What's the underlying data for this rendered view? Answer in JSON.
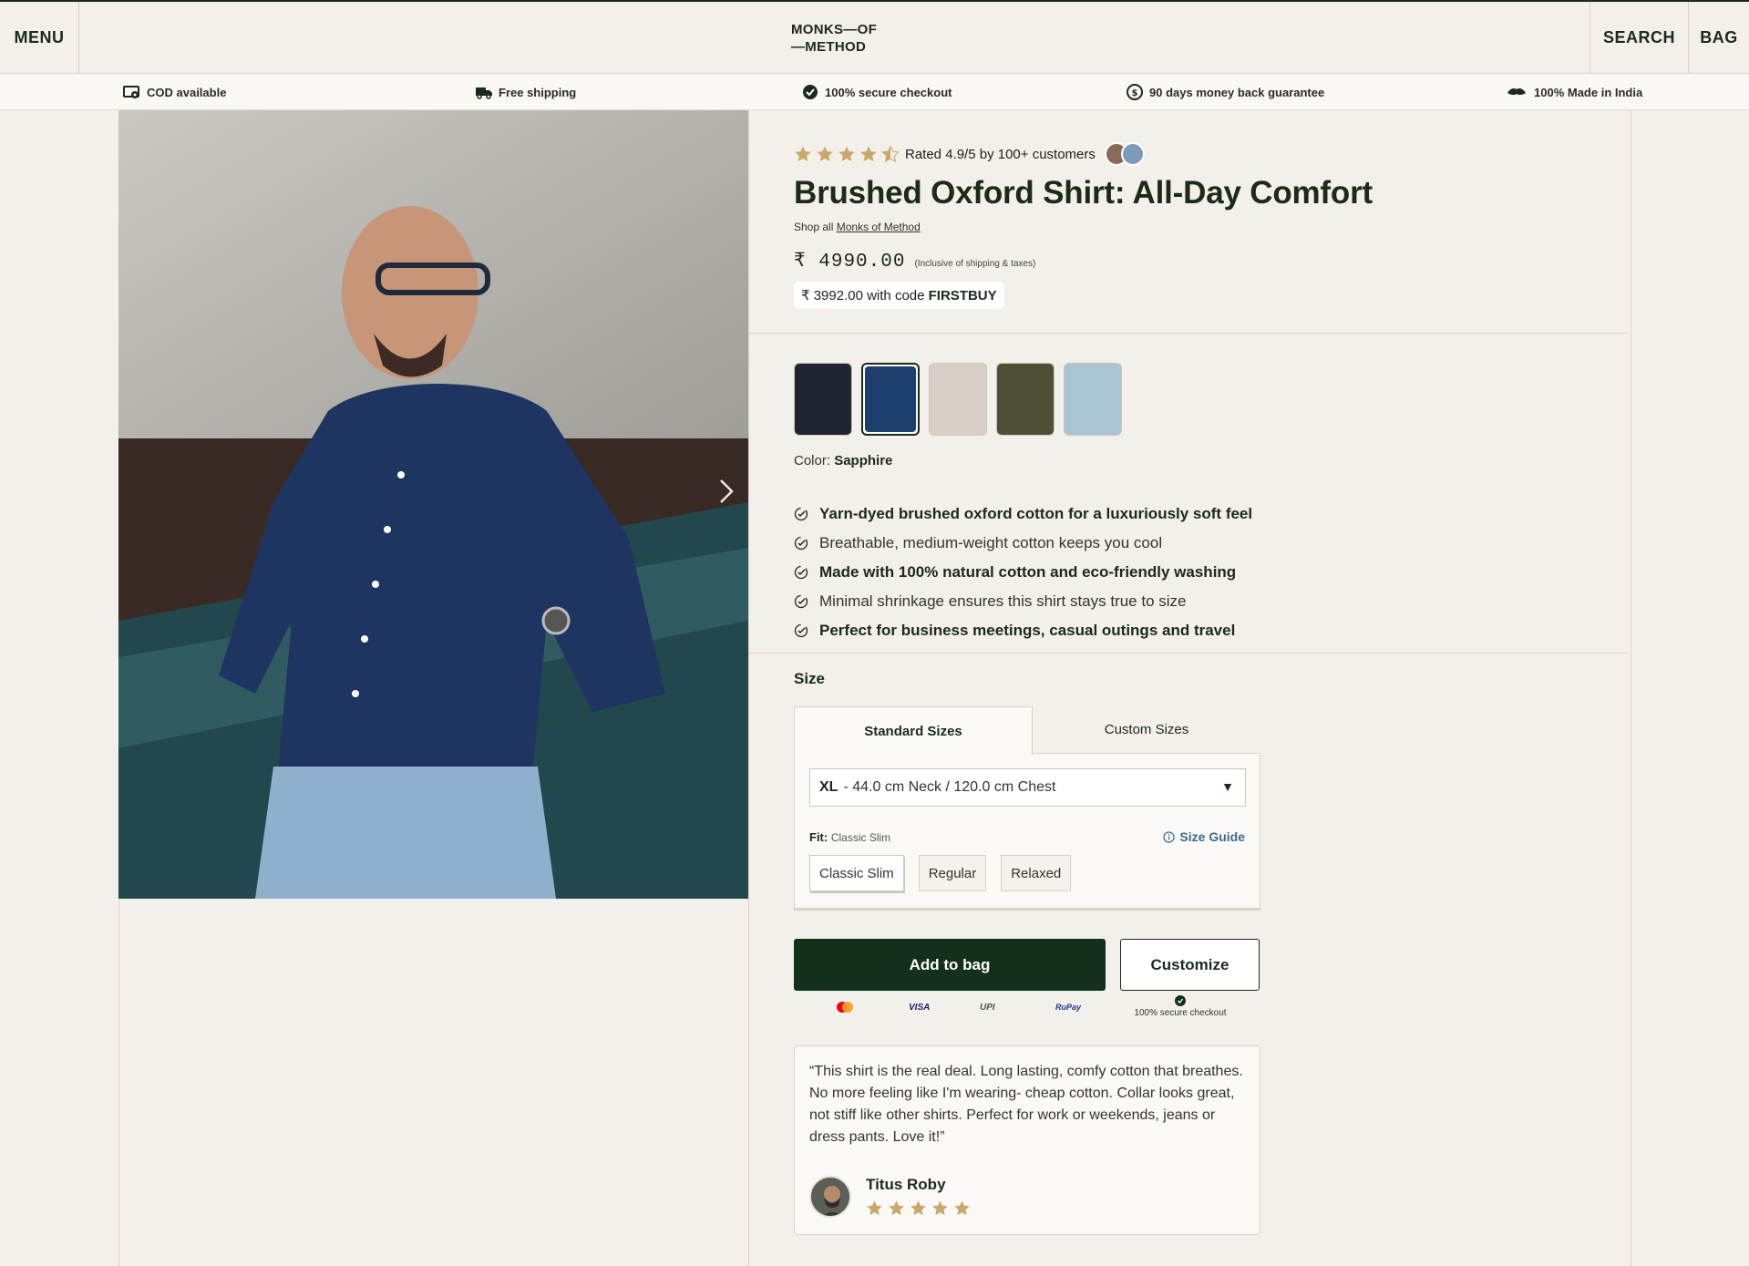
{
  "header": {
    "menu_label": "MENU",
    "logo_line1": "MONKS—OF",
    "logo_line2": "—METHOD",
    "search_label": "SEARCH",
    "bag_label": "BAG"
  },
  "trustbar": [
    {
      "icon": "cod-icon",
      "label": "COD available"
    },
    {
      "icon": "truck-icon",
      "label": "Free shipping"
    },
    {
      "icon": "shield-check-icon",
      "label": "100% secure checkout"
    },
    {
      "icon": "money-back-icon",
      "label": "90 days money back guarantee"
    },
    {
      "icon": "india-icon",
      "label": "100% Made in India"
    }
  ],
  "product": {
    "rating_text": "Rated 4.9/5 by 100+ customers",
    "rating_value": 4.5,
    "title": "Brushed Oxford Shirt: All-Day Comfort",
    "shop_all_prefix": "Shop all",
    "shop_all_link": "Monks of Method",
    "price": "₹ 4990.00",
    "price_note": "(Inclusive of shipping & taxes)",
    "discount_prefix": "₹ 3992.00 with code",
    "discount_code": "FIRSTBUY",
    "color_prefix": "Color:",
    "color_value": "Sapphire",
    "swatches": [
      {
        "name": "Black",
        "color": "#1f2430"
      },
      {
        "name": "Sapphire",
        "color": "#1d3f6e",
        "selected": true
      },
      {
        "name": "Beige",
        "color": "#d7cfc8"
      },
      {
        "name": "Olive",
        "color": "#4d5034"
      },
      {
        "name": "Sky",
        "color": "#a9c4d2"
      }
    ],
    "features": [
      {
        "text": "Yarn-dyed brushed oxford cotton for a luxuriously soft feel",
        "bold": true
      },
      {
        "text": "Breathable, medium-weight cotton keeps you cool",
        "bold": false
      },
      {
        "text": "Made with 100% natural cotton and eco-friendly washing",
        "bold": true
      },
      {
        "text": "Minimal shrinkage ensures this shirt stays true to size",
        "bold": false
      },
      {
        "text": "Perfect for business meetings, casual outings and travel",
        "bold": true
      }
    ]
  },
  "size": {
    "label": "Size",
    "tab_standard": "Standard Sizes",
    "tab_custom": "Custom Sizes",
    "selected_size": "XL",
    "selected_desc": "- 44.0 cm Neck / 120.0 cm Chest",
    "fit_label": "Fit:",
    "fit_value": "Classic Slim",
    "size_guide": "Size Guide",
    "fit_options": [
      "Classic Slim",
      "Regular",
      "Relaxed"
    ]
  },
  "actions": {
    "add_to_bag": "Add to bag",
    "customize": "Customize",
    "secure_checkout": "100% secure checkout",
    "payments": [
      "Mastercard",
      "VISA",
      "UPI",
      "RuPay"
    ]
  },
  "review": {
    "text": "“This shirt is the real deal. Long lasting, comfy cotton that breathes. No more feeling like I'm wearing- cheap cotton. Collar looks great, not stiff like other shirts. Perfect for work or weekends, jeans or dress pants. Love it!”",
    "name": "Titus Roby",
    "stars": 5
  },
  "colors": {
    "brand_dark": "#13301d",
    "star": "#c9a86a",
    "background": "#f3efea"
  }
}
